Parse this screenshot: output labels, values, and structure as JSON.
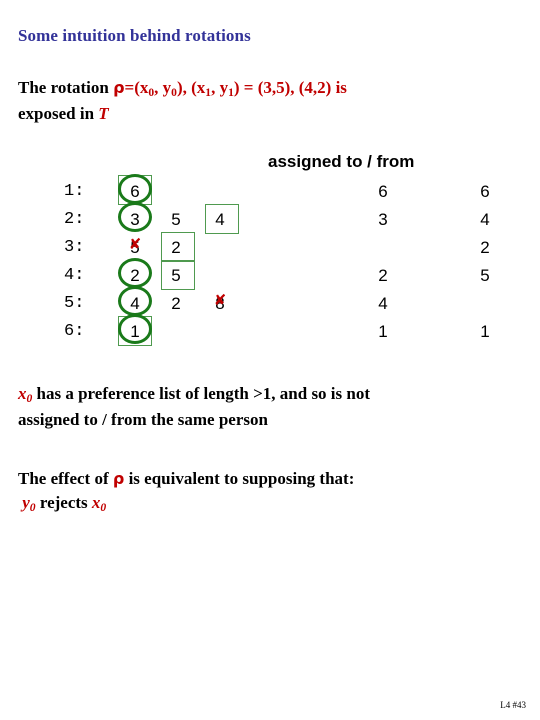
{
  "slide": {
    "title": "Some intuition behind rotations",
    "footer": "L4 #43"
  },
  "intro": {
    "lead": "The rotation ",
    "rho": "ρ",
    "formula": "=(x",
    "sub0a": "0",
    "comma1": ", y",
    "sub0b": "0",
    "mid": "), (x",
    "sub1a": "1",
    "comma2": ", y",
    "sub1b": "1",
    "tail": ") = (3,5), (4,2) is",
    "line2_lead": "exposed in ",
    "line2_T": "T"
  },
  "table": {
    "header": "assigned to / from",
    "columns": [
      "person",
      "pref1",
      "pref2",
      "pref3",
      "assigned_to",
      "assigned_from"
    ],
    "rows": [
      {
        "label": "1:",
        "prefs": [
          "6",
          "",
          ""
        ],
        "to": "6",
        "from": "6"
      },
      {
        "label": "2:",
        "prefs": [
          "3",
          "5",
          "4"
        ],
        "to": "3",
        "from": "4"
      },
      {
        "label": "3:",
        "prefs": [
          "5",
          "2",
          ""
        ],
        "to": "",
        "from": "2"
      },
      {
        "label": "4:",
        "prefs": [
          "2",
          "5",
          ""
        ],
        "to": "2",
        "from": "5"
      },
      {
        "label": "5:",
        "prefs": [
          "4",
          "2",
          "8"
        ],
        "to": "4",
        "from": ""
      },
      {
        "label": "6:",
        "prefs": [
          "1",
          "",
          ""
        ],
        "to": "1",
        "from": "1"
      }
    ],
    "annotations": {
      "circled_prefs": [
        "row1.pref1",
        "row2.pref1",
        "row4.pref1",
        "row5.pref1",
        "row6.pref1"
      ],
      "boxed_prefs": [
        "row1.pref1",
        "row2.pref3",
        "row3.pref2",
        "row4.pref2",
        "row6.pref1"
      ],
      "crossed_out": [
        "row3.pref1",
        "row5.pref3"
      ],
      "x_glyph": "✘"
    }
  },
  "notes": {
    "preference_line1_x": "x",
    "preference_line1_sub": "0",
    "preference_line1_rest": " has a preference list of length >1, and so is not",
    "preference_line2": "assigned to / from the same person",
    "effect_lead": "The effect of ",
    "effect_rho": "ρ",
    "effect_rest": " is equivalent to supposing that:",
    "effect_line2_y": "y",
    "effect_line2_ysub": "0",
    "effect_line2_mid": " rejects ",
    "effect_line2_x": "x",
    "effect_line2_xsub": "0"
  },
  "colors": {
    "title": "#333399",
    "accent_red": "#C00000",
    "annotation_green": "#1a7a1a",
    "box_green": "#4f9a4f",
    "text": "#000000",
    "background": "#ffffff"
  }
}
